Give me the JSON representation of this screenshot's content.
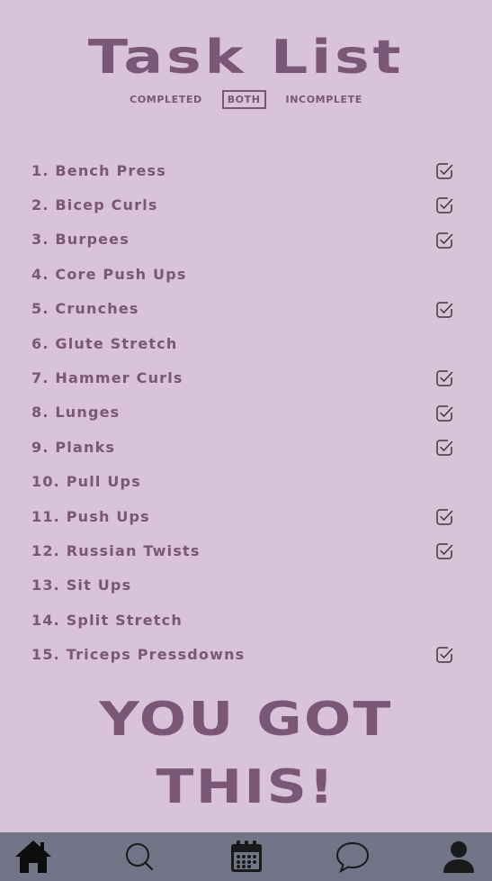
{
  "header": {
    "title": "Task List"
  },
  "filters": {
    "completed": "COMPLETED",
    "both": "BOTH",
    "incomplete": "INCOMPLETE",
    "selected": "BOTH"
  },
  "tasks": [
    {
      "label": "1. Bench Press",
      "checked": true
    },
    {
      "label": "2. Bicep Curls",
      "checked": true
    },
    {
      "label": "3. Burpees",
      "checked": true
    },
    {
      "label": "4. Core Push Ups",
      "checked": false
    },
    {
      "label": "5. Crunches",
      "checked": true
    },
    {
      "label": "6. Glute Stretch",
      "checked": false
    },
    {
      "label": "7. Hammer Curls",
      "checked": true
    },
    {
      "label": "8. Lunges",
      "checked": true
    },
    {
      "label": "9. Planks",
      "checked": true
    },
    {
      "label": "10. Pull Ups",
      "checked": false
    },
    {
      "label": "11. Push Ups",
      "checked": true
    },
    {
      "label": "12. Russian Twists",
      "checked": true
    },
    {
      "label": "13. Sit Ups",
      "checked": false
    },
    {
      "label": "14. Split Stretch",
      "checked": false
    },
    {
      "label": "15. Triceps Pressdowns",
      "checked": true
    }
  ],
  "motivation": {
    "line1": "YOU GOT",
    "line2": "THIS!"
  },
  "nav": {
    "items": [
      "home-icon",
      "search-icon",
      "calendar-icon",
      "chat-icon",
      "profile-icon"
    ],
    "active": "home-icon"
  },
  "colors": {
    "background": "#d8c3d9",
    "accent": "#7a5677",
    "navbar": "#727487",
    "nav_icon_active": "#0d0d0d",
    "nav_icon": "#1a1a1a"
  }
}
